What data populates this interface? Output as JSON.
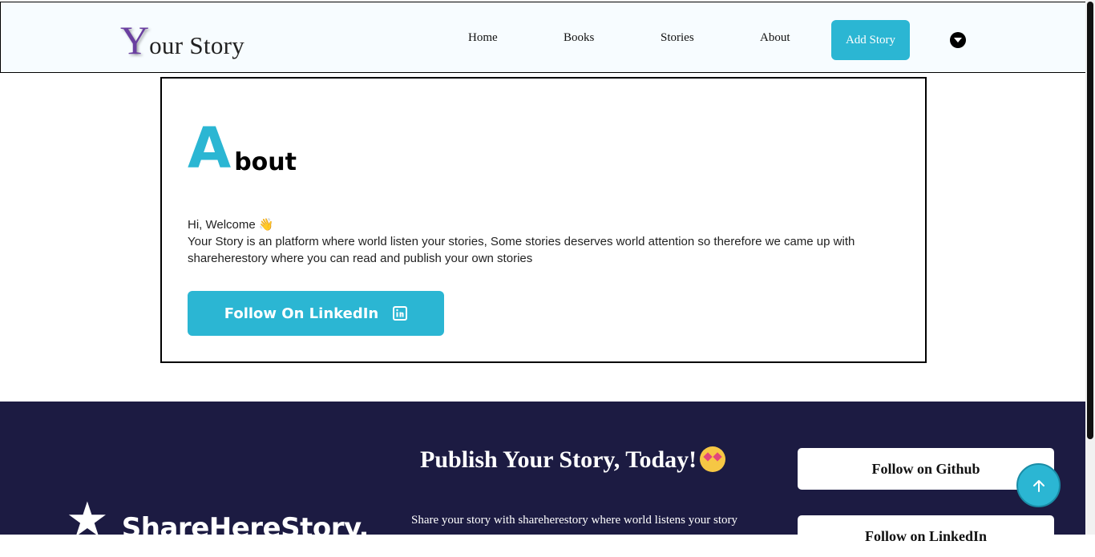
{
  "header": {
    "logo_initial": "Y",
    "logo_rest": "our Story",
    "nav": [
      "Home",
      "Books",
      "Stories",
      "About"
    ],
    "add_story": "Add Story"
  },
  "about": {
    "title_initial": "A",
    "title_rest": "bout",
    "welcome": "Hi, Welcome 👋",
    "description": "Your Story is an platform where world listen your stories, Some stories deserves world attention so therefore we came up with shareherestory where you can read and publish your own stories",
    "linkedin_button": "Follow On LinkedIn"
  },
  "footer": {
    "brand_star": "★",
    "brand_name": "ShareHereStory.",
    "title": "Publish Your Story, Today!",
    "subtitle": "Share your story with shareherestory where world listens your story",
    "github_button": "Follow on Github",
    "linkedin_button": "Follow on LinkedIn"
  },
  "colors": {
    "accent": "#2bb6d3",
    "footer_bg": "#1c1b42",
    "logo_purple": "#6a3fa0"
  }
}
